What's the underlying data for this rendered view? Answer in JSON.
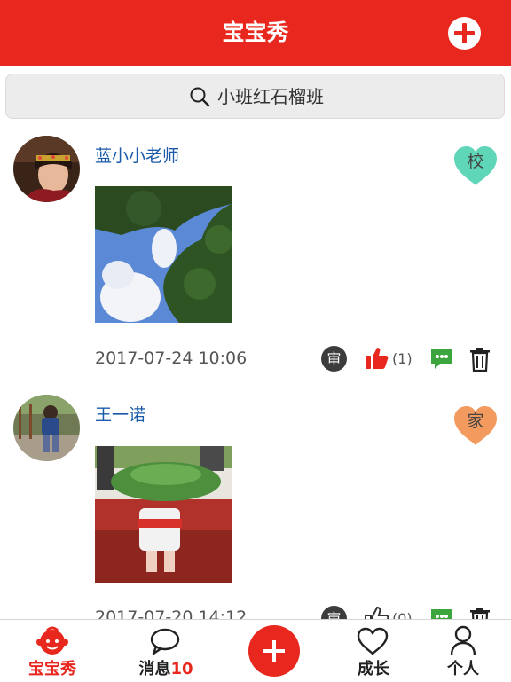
{
  "header": {
    "title": "宝宝秀",
    "add_icon": "plus-circle-icon"
  },
  "search": {
    "text": "小班红石榴班",
    "icon": "search-icon"
  },
  "posts": [
    {
      "author": "蓝小小老师",
      "badge": "校",
      "badge_color": "#5fd6b8",
      "timestamp": "2017-07-24 10:06",
      "review_icon_label": "审",
      "like_count": "(1)"
    },
    {
      "author": "王一诺",
      "badge": "家",
      "badge_color": "#f39a5e",
      "timestamp": "2017-07-20 14:12",
      "review_icon_label": "审",
      "like_count": "(0)"
    }
  ],
  "tabs": [
    {
      "label": "宝宝秀",
      "icon": "baby-face-icon",
      "active": true
    },
    {
      "label": "消息",
      "count": "10",
      "icon": "chat-bubble-icon"
    },
    {
      "label": "",
      "icon": "plus-icon"
    },
    {
      "label": "成长",
      "icon": "heart-icon"
    },
    {
      "label": "个人",
      "icon": "person-icon"
    }
  ],
  "colors": {
    "brand": "#e8281e",
    "author": "#1a5aa8",
    "comment_icon": "#3da53d",
    "like_icon": "#e8281e"
  }
}
